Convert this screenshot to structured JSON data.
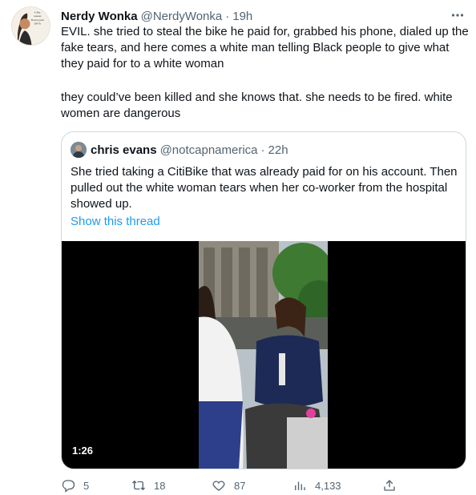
{
  "tweet": {
    "author_name": "Nerdy Wonka",
    "author_handle": "@NerdyWonka",
    "separator": "·",
    "time": "19h",
    "avatar_caption": "A Bio. Lesser Brains Jerk Off To",
    "more_icon": "more-horizontal-icon",
    "text_line_1": "EVIL. she tried to steal the bike he paid for, grabbed his phone, dialed up the fake tears, and here comes a white man telling Black people to give what they paid for to a white woman",
    "text_line_2": "they could’ve been killed and she knows that. she needs to be fired. white women are dangerous"
  },
  "quoted_tweet": {
    "author_name": "chris evans",
    "author_handle": "@notcapnamerica",
    "separator": "·",
    "time": "22h",
    "text": "She tried taking a CitiBike that was already paid for on his account. Then pulled out the white woman tears when her co-worker from the hospital showed up.",
    "show_thread": "Show this thread",
    "video_duration": "1:26"
  },
  "actions": {
    "replies": "5",
    "retweets": "18",
    "likes": "87",
    "views": "4,133"
  },
  "colors": {
    "link": "#1d9bf0",
    "secondary_text": "#536471",
    "border": "#cfd9de"
  }
}
